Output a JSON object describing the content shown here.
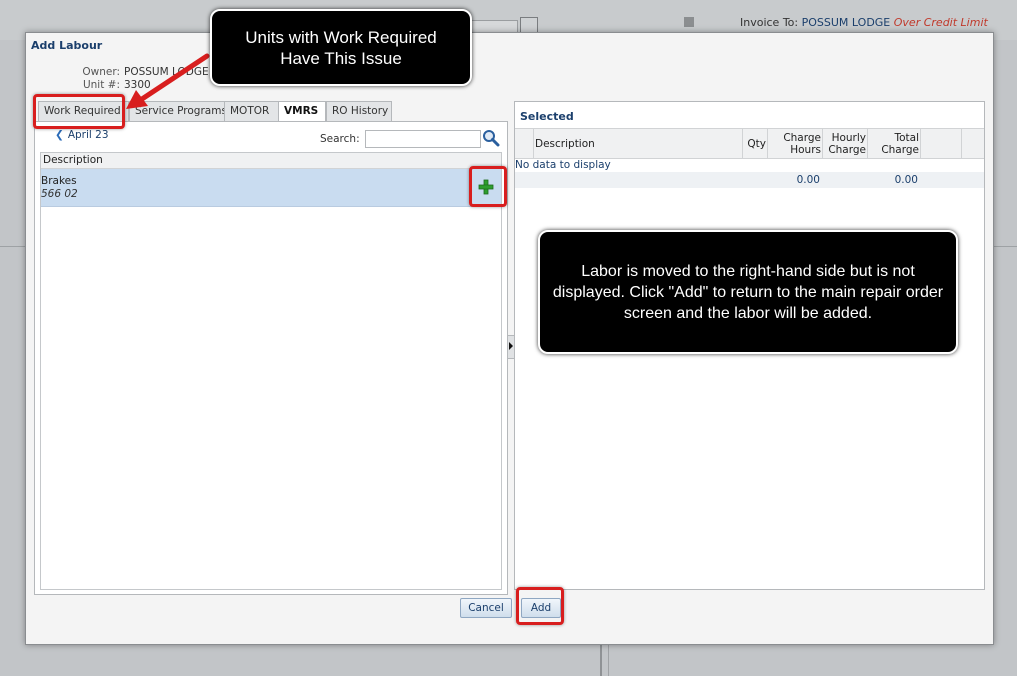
{
  "background": {
    "invoice_label": "Invoice To:",
    "invoice_name": "POSSUM LODGE",
    "invoice_warning": "Over Credit Limit"
  },
  "dialog": {
    "title": "Add Labour",
    "owner_label": "Owner:",
    "owner_value": "POSSUM LODGE",
    "unit_label": "Unit #:",
    "unit_value": "3300"
  },
  "tabs": [
    {
      "label": "Work Required"
    },
    {
      "label": "Service Programs"
    },
    {
      "label": "MOTOR"
    },
    {
      "label": "VMRS"
    },
    {
      "label": "RO History"
    }
  ],
  "active_tab": "VMRS",
  "left": {
    "nav_label": "April 23",
    "search_label": "Search:",
    "search_value": "",
    "column_header": "Description",
    "rows": [
      {
        "line1": "Brakes",
        "line2": "566 02"
      }
    ]
  },
  "right": {
    "title": "Selected",
    "columns": [
      "Description",
      "Qty",
      "Charge Hours",
      "Hourly Charge",
      "Total Charge"
    ],
    "empty_text": "No data to display",
    "totals": {
      "charge_hours": "0.00",
      "total_charge": "0.00"
    }
  },
  "buttons": {
    "cancel": "Cancel",
    "add": "Add"
  },
  "callouts": {
    "top": "Units with Work Required Have This Issue",
    "right": "Labor is moved to the right-hand side but is not displayed. Click \"Add\" to return to the main repair order screen and the labor will be added."
  },
  "colors": {
    "accent": "#1b3f6c",
    "highlight": "#d81e1e",
    "selected_row": "#c9dcf0",
    "add_icon": "#2e9e2e"
  }
}
